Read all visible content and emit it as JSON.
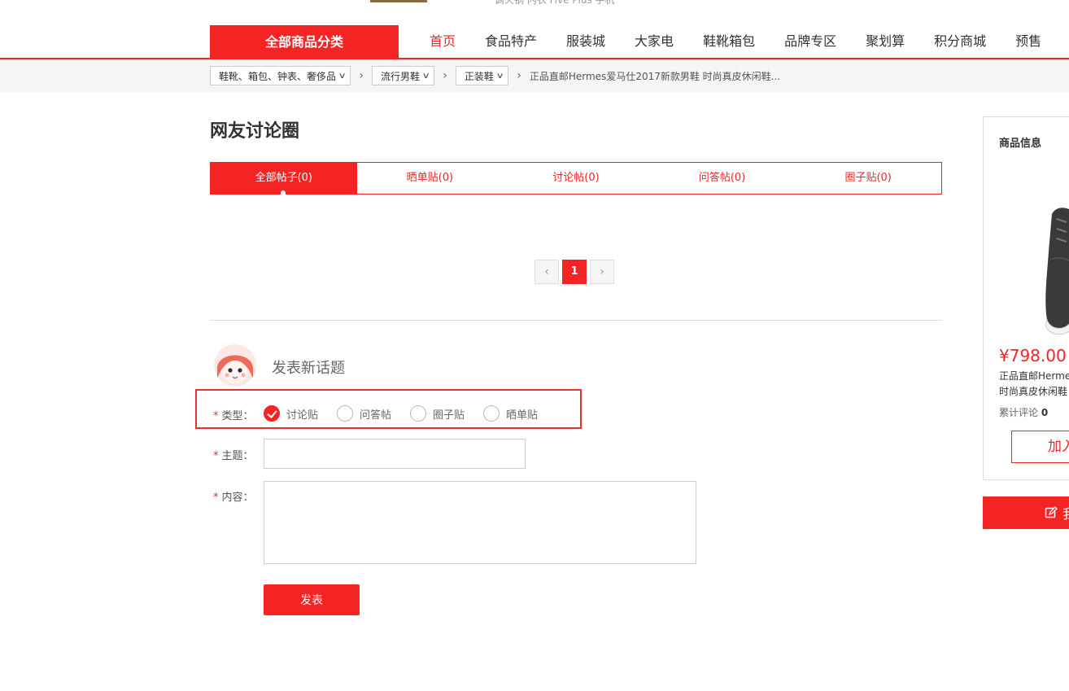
{
  "top": {
    "hot_words": "调火锅  内衣  Five Plus  手机"
  },
  "nav": {
    "all_categories": "全部商品分类",
    "items": [
      "首页",
      "食品特产",
      "服装城",
      "大家电",
      "鞋靴箱包",
      "品牌专区",
      "聚划算",
      "积分商城",
      "预售"
    ]
  },
  "breadcrumb": {
    "level1": "鞋靴、箱包、钟表、奢侈品",
    "level2": "流行男鞋",
    "level3": "正装鞋",
    "current": "正品直邮Hermes爱马仕2017新款男鞋 时尚真皮休闲鞋..."
  },
  "discussion": {
    "title": "网友讨论圈",
    "tabs": [
      "全部帖子(0)",
      "晒单贴(0)",
      "讨论帖(0)",
      "问答帖(0)",
      "圈子贴(0)"
    ],
    "pager": {
      "prev": "‹",
      "current": "1",
      "next": "›"
    }
  },
  "form": {
    "heading": "发表新话题",
    "type_label": "类型：",
    "types": [
      "讨论贴",
      "问答帖",
      "圈子贴",
      "晒单贴"
    ],
    "selected_type": "讨论贴",
    "subject_label": "主题：",
    "subject_value": "",
    "content_label": "内容：",
    "content_value": "",
    "required_mark": "*",
    "submit": "发表"
  },
  "sidebar": {
    "title": "商品信息",
    "price": "¥798.00",
    "name_line1": "正品直邮Hermes",
    "name_line2": "时尚真皮休闲鞋",
    "reviews_label": "累计评论",
    "reviews_count": "0",
    "add_to_cart": "加入",
    "post_button": "我"
  },
  "colors": {
    "accent": "#f42424",
    "highlight_box": "#e43333"
  }
}
